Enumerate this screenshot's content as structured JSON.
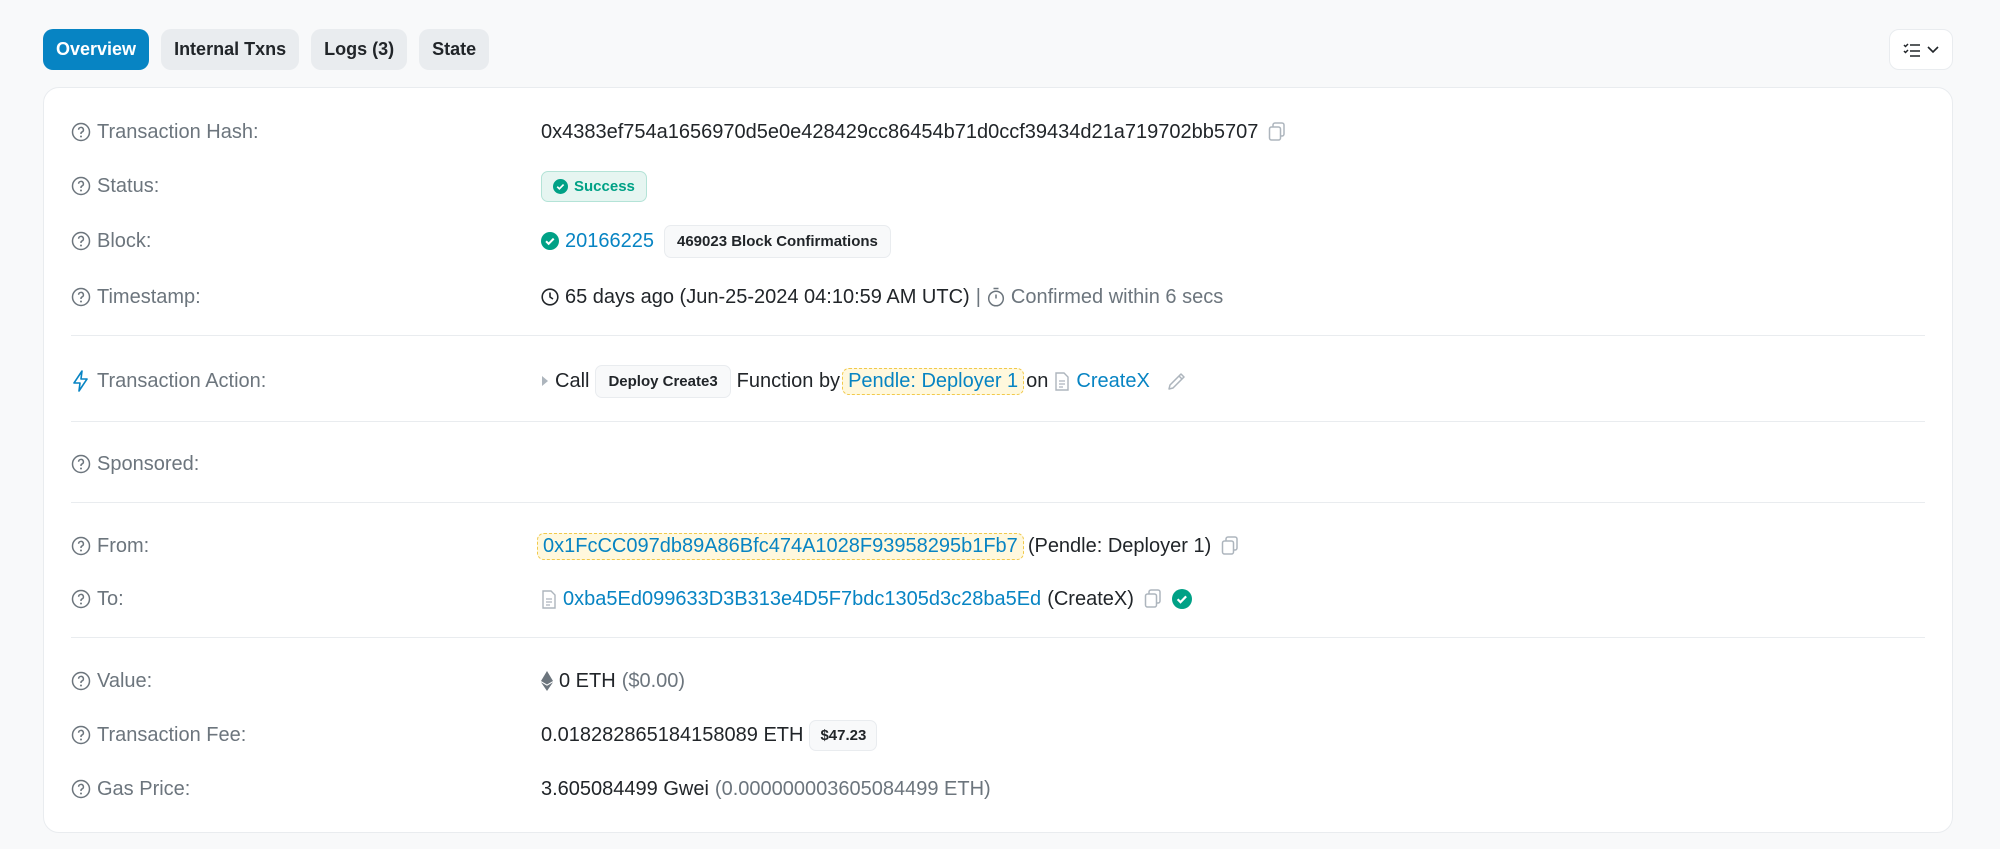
{
  "tabs": [
    {
      "label": "Overview",
      "active": true
    },
    {
      "label": "Internal Txns",
      "active": false
    },
    {
      "label": "Logs (3)",
      "active": false
    },
    {
      "label": "State",
      "active": false
    }
  ],
  "rows": {
    "tx_hash": {
      "label": "Transaction Hash:",
      "value": "0x4383ef754a1656970d5e0e428429cc86454b71d0ccf39434d21a719702bb5707"
    },
    "status": {
      "label": "Status:",
      "value": "Success"
    },
    "block": {
      "label": "Block:",
      "value": "20166225",
      "confirmations": "469023 Block Confirmations"
    },
    "timestamp": {
      "label": "Timestamp:",
      "value": "65 days ago (Jun-25-2024 04:10:59 AM UTC)",
      "separator": "|",
      "confirmed": "Confirmed within 6 secs"
    },
    "action": {
      "label": "Transaction Action:",
      "call": "Call",
      "method": "Deploy Create3",
      "function_by": "Function by",
      "caller": "Pendle: Deployer 1",
      "on": "on",
      "contract": "CreateX"
    },
    "sponsored": {
      "label": "Sponsored:"
    },
    "from": {
      "label": "From:",
      "address": "0x1FcCC097db89A86Bfc474A1028F93958295b1Fb7",
      "name": "(Pendle: Deployer 1)"
    },
    "to": {
      "label": "To:",
      "address": "0xba5Ed099633D3B313e4D5F7bdc1305d3c28ba5Ed",
      "name": "(CreateX)"
    },
    "value": {
      "label": "Value:",
      "amount": "0 ETH",
      "usd": "($0.00)"
    },
    "fee": {
      "label": "Transaction Fee:",
      "amount": "0.018282865184158089 ETH",
      "usd": "$47.23"
    },
    "gas_price": {
      "label": "Gas Price:",
      "gwei": "3.605084499 Gwei",
      "eth": "(0.000000003605084499 ETH)"
    }
  },
  "colors": {
    "accent": "#0784c3",
    "success": "#00a186",
    "muted": "#6c757d"
  }
}
